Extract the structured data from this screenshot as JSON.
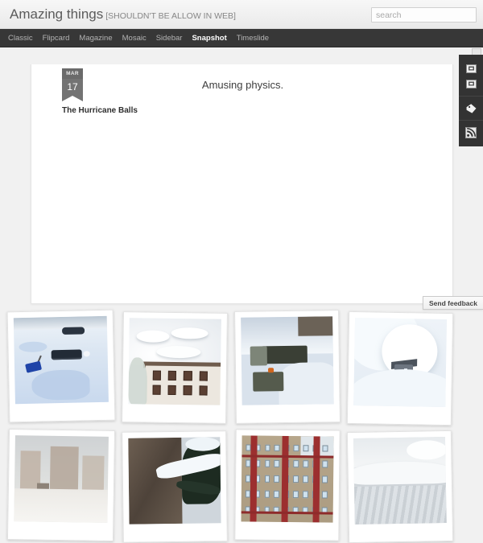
{
  "header": {
    "title_main": "Amazing things",
    "title_sub": "[SHOULDN'T BE ALLOW IN WEB]",
    "search_placeholder": "search",
    "search_value": ""
  },
  "nav": {
    "items": [
      {
        "label": "Classic",
        "active": false
      },
      {
        "label": "Flipcard",
        "active": false
      },
      {
        "label": "Magazine",
        "active": false
      },
      {
        "label": "Mosaic",
        "active": false
      },
      {
        "label": "Sidebar",
        "active": false
      },
      {
        "label": "Snapshot",
        "active": true
      },
      {
        "label": "Timeslide",
        "active": false
      }
    ]
  },
  "post": {
    "date_month": "MAR",
    "date_day": "17",
    "title": "The Hurricane Balls",
    "body": "Amusing physics."
  },
  "rail": {
    "icons": [
      {
        "name": "share-icon",
        "group": 0
      },
      {
        "name": "bookmark-icon",
        "group": 0
      },
      {
        "name": "tag-icon",
        "group": 1
      },
      {
        "name": "rss-icon",
        "group": 2
      }
    ]
  },
  "feedback": {
    "label": "Send feedback"
  },
  "photos": [
    {
      "caption": "",
      "style": "ph1"
    },
    {
      "caption": "",
      "style": "ph2"
    },
    {
      "caption": "",
      "style": "ph3"
    },
    {
      "caption": "",
      "style": "ph4"
    },
    {
      "caption": "",
      "style": "ph5"
    },
    {
      "caption": "",
      "style": "ph6"
    },
    {
      "caption": "",
      "style": "ph7"
    },
    {
      "caption": "",
      "style": "ph8"
    }
  ],
  "colors": {
    "header_bg": "#efefef",
    "nav_bg": "#373737",
    "nav_active": "#ffffff",
    "page_bg": "#f1f1f1",
    "panel_bg": "#ffffff",
    "rail_bg": "#333333",
    "ribbon_bg": "#737373"
  }
}
